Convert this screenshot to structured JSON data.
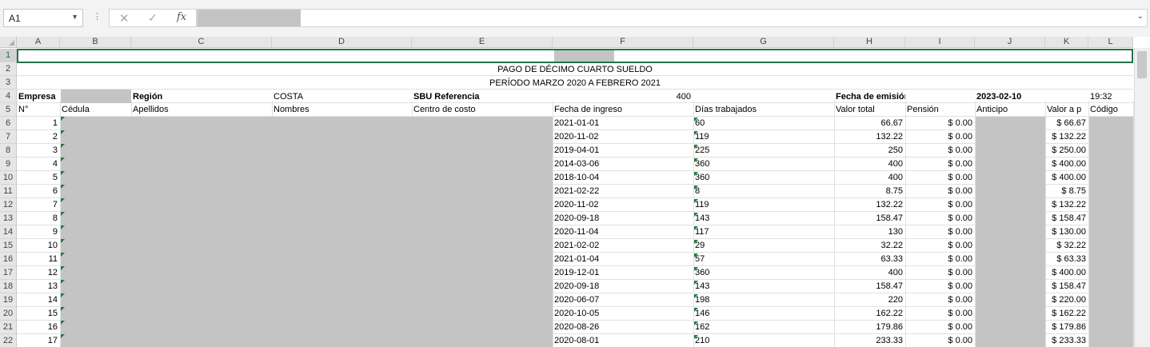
{
  "formula_bar": {
    "name_box": "A1",
    "fx_label": "fx",
    "formula_value": ""
  },
  "icons": {
    "name_box_dropdown": "chevron-down-icon",
    "more_options": "vertical-dots-icon",
    "cancel": "x-icon",
    "enter": "checkmark-icon",
    "insert_function": "fx-icon",
    "expand_formula_bar": "chevron-down-icon"
  },
  "colors": {
    "accent": "#217346",
    "redaction": "#c4c4c4",
    "header_bg": "#e6e6e6"
  },
  "columns": [
    "A",
    "B",
    "C",
    "D",
    "E",
    "F",
    "G",
    "H",
    "I",
    "J",
    "K",
    "L"
  ],
  "rows": [
    "1",
    "2",
    "3",
    "4",
    "5",
    "6",
    "7",
    "8",
    "9",
    "10",
    "11",
    "12",
    "13",
    "14",
    "15",
    "16",
    "17",
    "18",
    "19",
    "20",
    "21",
    "22"
  ],
  "sheet": {
    "title": "PAGO DE DÉCIMO CUARTO SUELDO",
    "period": "PERÍODO MARZO 2020 A FEBRERO 2021",
    "info": {
      "empresa_label": "Empresa",
      "region_label": "Región",
      "region_value": "COSTA",
      "sbu_label": "SBU Referencia",
      "sbu_value": "400",
      "fecha_emision_label": "Fecha de emisión",
      "fecha_emision_value": "2023-02-10",
      "time_value": "19:32"
    },
    "headers": {
      "A": "N°",
      "B": "Cédula",
      "C": "Apellidos",
      "D": "Nombres",
      "E": "Centro de costo",
      "F": "Fecha de ingreso",
      "G": "Días trabajados",
      "H": "Valor total",
      "I": "Pensión",
      "J": "Anticipo",
      "K": "Valor a p",
      "L": "Código"
    },
    "data_rows": [
      {
        "n": "1",
        "fecha": "2021-01-01",
        "dias": "60",
        "total": "66.67",
        "pension": "$ 0.00",
        "pagar": "$ 66.67"
      },
      {
        "n": "2",
        "fecha": "2020-11-02",
        "dias": "119",
        "total": "132.22",
        "pension": "$ 0.00",
        "pagar": "$ 132.22"
      },
      {
        "n": "3",
        "fecha": "2019-04-01",
        "dias": "225",
        "total": "250",
        "pension": "$ 0.00",
        "pagar": "$ 250.00"
      },
      {
        "n": "4",
        "fecha": "2014-03-06",
        "dias": "360",
        "total": "400",
        "pension": "$ 0.00",
        "pagar": "$ 400.00"
      },
      {
        "n": "5",
        "fecha": "2018-10-04",
        "dias": "360",
        "total": "400",
        "pension": "$ 0.00",
        "pagar": "$ 400.00"
      },
      {
        "n": "6",
        "fecha": "2021-02-22",
        "dias": "8",
        "total": "8.75",
        "pension": "$ 0.00",
        "pagar": "$ 8.75"
      },
      {
        "n": "7",
        "fecha": "2020-11-02",
        "dias": "119",
        "total": "132.22",
        "pension": "$ 0.00",
        "pagar": "$ 132.22"
      },
      {
        "n": "8",
        "fecha": "2020-09-18",
        "dias": "143",
        "total": "158.47",
        "pension": "$ 0.00",
        "pagar": "$ 158.47"
      },
      {
        "n": "9",
        "fecha": "2020-11-04",
        "dias": "117",
        "total": "130",
        "pension": "$ 0.00",
        "pagar": "$ 130.00"
      },
      {
        "n": "10",
        "fecha": "2021-02-02",
        "dias": "29",
        "total": "32.22",
        "pension": "$ 0.00",
        "pagar": "$ 32.22"
      },
      {
        "n": "11",
        "fecha": "2021-01-04",
        "dias": "57",
        "total": "63.33",
        "pension": "$ 0.00",
        "pagar": "$ 63.33"
      },
      {
        "n": "12",
        "fecha": "2019-12-01",
        "dias": "360",
        "total": "400",
        "pension": "$ 0.00",
        "pagar": "$ 400.00"
      },
      {
        "n": "13",
        "fecha": "2020-09-18",
        "dias": "143",
        "total": "158.47",
        "pension": "$ 0.00",
        "pagar": "$ 158.47"
      },
      {
        "n": "14",
        "fecha": "2020-06-07",
        "dias": "198",
        "total": "220",
        "pension": "$ 0.00",
        "pagar": "$ 220.00"
      },
      {
        "n": "15",
        "fecha": "2020-10-05",
        "dias": "146",
        "total": "162.22",
        "pension": "$ 0.00",
        "pagar": "$ 162.22"
      },
      {
        "n": "16",
        "fecha": "2020-08-26",
        "dias": "162",
        "total": "179.86",
        "pension": "$ 0.00",
        "pagar": "$ 179.86"
      },
      {
        "n": "17",
        "fecha": "2020-08-01",
        "dias": "210",
        "total": "233.33",
        "pension": "$ 0.00",
        "pagar": "$ 233.33"
      }
    ]
  }
}
